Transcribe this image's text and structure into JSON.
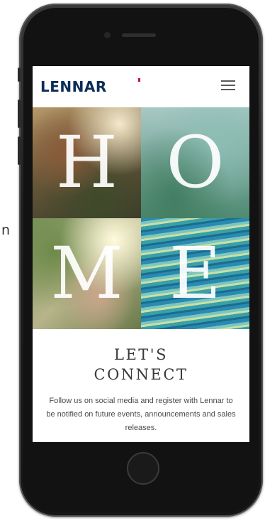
{
  "stray_text": "n",
  "app": {
    "brand": "LENNAR",
    "menu_icon": "hamburger-menu-icon"
  },
  "hero": {
    "letters": [
      "H",
      "O",
      "M",
      "E"
    ]
  },
  "connect": {
    "title_line1": "LET'S",
    "title_line2": "CONNECT",
    "body": "Follow us on social media and register with Lennar to be notified on future events, announcements and sales releases."
  },
  "colors": {
    "brand": "#0c2d5a",
    "brand_accent": "#c8102e",
    "text": "#4a4a4a"
  }
}
